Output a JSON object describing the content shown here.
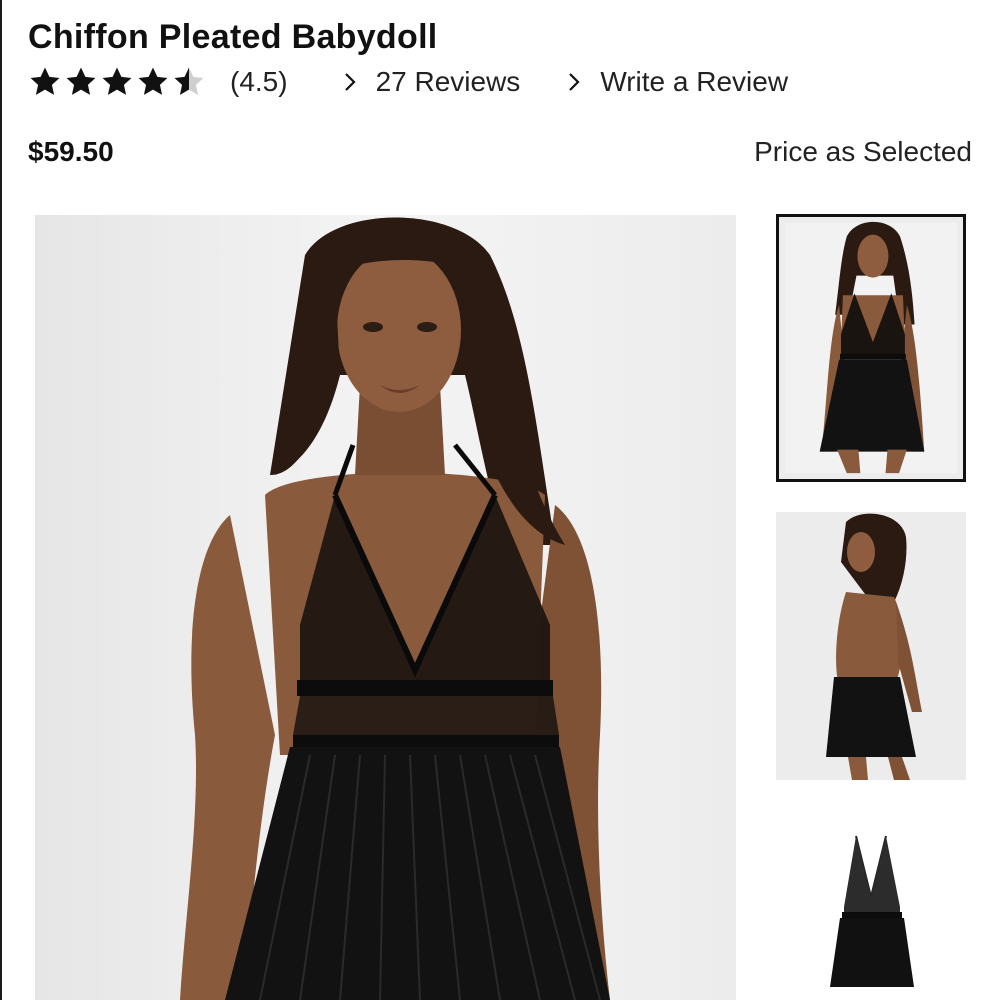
{
  "product": {
    "title": "Chiffon Pleated Babydoll",
    "rating_value": 4.5,
    "rating_text": "(4.5)",
    "reviews_link": "27 Reviews",
    "write_review_link": "Write a Review",
    "price": "$59.50",
    "price_note": "Price as Selected"
  },
  "colors": {
    "text": "#111111",
    "garment": "#111111",
    "skin": "#8a5a3c",
    "backdrop": "#efefef"
  },
  "icons": {
    "star": "star-icon",
    "chevron": "chevron-right-icon"
  },
  "gallery": {
    "selected_index": 0,
    "thumbnail_count": 3
  }
}
